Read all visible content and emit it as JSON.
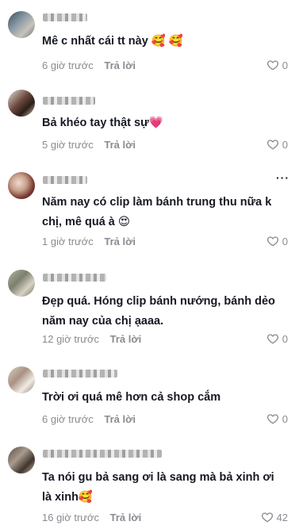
{
  "comments": [
    {
      "text": "Mê c nhất cái tt này 🥰 🥰",
      "time": "6 giờ trước",
      "reply": "Trả lời",
      "likes": "0"
    },
    {
      "text": "Bả khéo tay thật sự💗",
      "time": "5 giờ trước",
      "reply": "Trả lời",
      "likes": "0"
    },
    {
      "text": "Năm nay có clip làm bánh trung thu nữa k chị, mê quá à 😍",
      "time": "1 giờ trước",
      "reply": "Trả lời",
      "likes": "0",
      "more": "···"
    },
    {
      "text": "Đẹp quá. Hóng clip bánh nướng, bánh dẻo năm nay của chị ạaaa.",
      "time": "12 giờ trước",
      "reply": "Trả lời",
      "likes": "0"
    },
    {
      "text": "Trời ơi quá mê hơn cả shop cắm",
      "time": "6 giờ trước",
      "reply": "Trả lời",
      "likes": "0"
    },
    {
      "text": "Ta nói gu bả sang ơi là sang mà bả xinh ơi là xinh🥰",
      "time": "16 giờ trước",
      "reply": "Trả lời",
      "likes": "42"
    }
  ],
  "colors": {
    "text": "#161823",
    "muted": "#8a8b91",
    "background": "#ffffff"
  },
  "icons": {
    "like": "heart-outline-icon",
    "more": "more-dots-icon"
  }
}
